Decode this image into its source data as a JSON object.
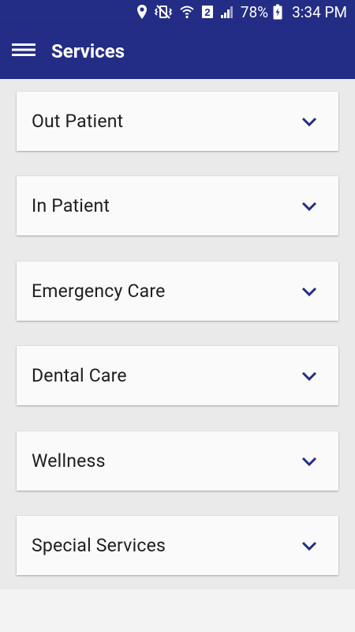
{
  "status_bar": {
    "battery": "78%",
    "time": "3:34 PM",
    "sim_slot": "2",
    "icons": [
      "location-icon",
      "vibrate-mute-icon",
      "wifi-icon",
      "sim-icon",
      "signal-icon",
      "battery-icon"
    ]
  },
  "app_bar": {
    "title": "Services",
    "menu_icon": "hamburger-menu-icon"
  },
  "services": [
    {
      "label": "Out Patient"
    },
    {
      "label": "In Patient"
    },
    {
      "label": "Emergency Care"
    },
    {
      "label": "Dental Care"
    },
    {
      "label": "Wellness"
    },
    {
      "label": "Special Services"
    }
  ],
  "colors": {
    "primary": "#232d85",
    "background": "#eaeaea",
    "card": "#fafafa",
    "text": "#1e1e1e",
    "chevron": "#232d85"
  }
}
